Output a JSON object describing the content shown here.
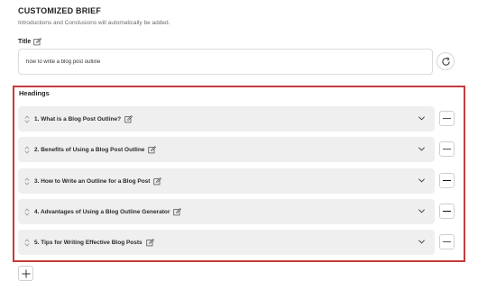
{
  "brief": {
    "title": "CUSTOMIZED BRIEF",
    "subtitle": "Introductions and Conclusions will automatically be added."
  },
  "title_field": {
    "label": "Title",
    "value": "how to write a blog post outline",
    "label_icon": "edit-icon",
    "refresh_icon": "refresh-icon"
  },
  "headings": {
    "label": "Headings",
    "items": [
      {
        "text": "1. What is a Blog Post Outline?"
      },
      {
        "text": "2. Benefits of Using a Blog Post Outline"
      },
      {
        "text": "3. How to Write an Outline for a Blog Post"
      },
      {
        "text": "4. Advantages of Using a Blog Outline Generator"
      },
      {
        "text": "5. Tips for Writing Effective Blog Posts"
      }
    ],
    "item_icons": [
      "drag-handle-icon",
      "edit-icon",
      "chevron-down-icon"
    ],
    "remove_icon": "minus-icon",
    "add_icon": "plus-icon"
  },
  "colors": {
    "highlight_border": "#c63a3a",
    "row_background": "#efefef"
  }
}
